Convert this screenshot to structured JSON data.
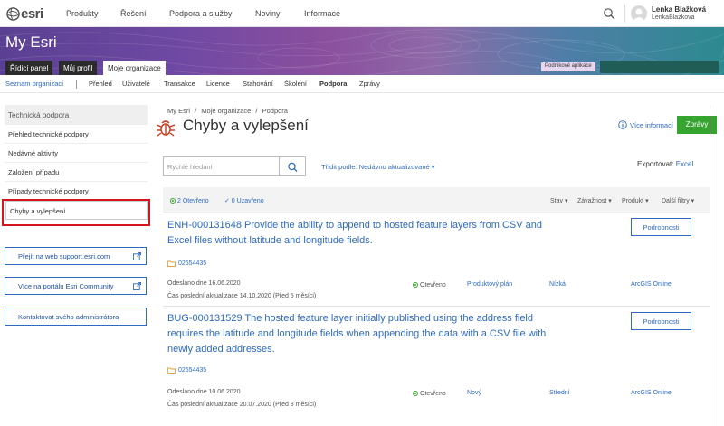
{
  "topnav": {
    "logo_text": "esri",
    "items": [
      "Produkty",
      "Řešení",
      "Podpora a služby",
      "Noviny",
      "Informace"
    ],
    "user_name": "Lenka Blažková",
    "user_login": "LenkaBlazkova"
  },
  "banner": {
    "title": "My Esri",
    "tabs": [
      "Řídicí panel",
      "Můj profil",
      "Moje organizace"
    ],
    "badge": "Podnikové aplikace"
  },
  "subnav": {
    "org_list": "Seznam organizací",
    "items": [
      "Přehled",
      "Uživatelé",
      "Transakce",
      "Licence",
      "Stahování",
      "Školení",
      "Podpora",
      "Zprávy"
    ]
  },
  "sidebar": {
    "heading": "Technická podpora",
    "items": [
      "Přehled technické podpory",
      "Nedávné aktivity",
      "Založení případu",
      "Případy technické podpory",
      "Chyby a vylepšení"
    ],
    "buttons": [
      "Přejít na web support.esri.com",
      "Více na portálu Esri Community",
      "Kontaktovat svého administrátora"
    ]
  },
  "main": {
    "breadcrumb": [
      "My Esri",
      "/",
      "Moje organizace",
      "/",
      "Podpora"
    ],
    "title": "Chyby a vylepšení",
    "info_link": "Více informací",
    "reports_btn": "Zprávy",
    "search_placeholder": "Rychlé hledání",
    "sort_label": "Třídit podle: Nedávno aktualizované ▾",
    "export_label": "Exportovat:",
    "export_link": "Excel",
    "filters": {
      "open": "2 Otevřeno",
      "closed": "✓ 0 Uzavřeno",
      "status": "Stav ▾",
      "severity": "Závažnost ▾",
      "product": "Produkt ▾",
      "more": "Další filtry ▾"
    }
  },
  "items": [
    {
      "title": "ENH-000131648 Provide the ability to append to hosted feature layers from CSV and Excel files without latitude and longitude fields.",
      "case": "02554435",
      "submitted": "Odesláno dne 16.06.2020",
      "updated": "Čas poslední aktualizace 14.10.2020 (Před 5 měsíci)",
      "status": "Otevřeno",
      "plan": "Produktový plán",
      "severity": "Nízká",
      "product": "ArcGIS Online",
      "details": "Podrobnosti"
    },
    {
      "title": "BUG-000131529 The hosted feature layer initially published using the address field requires the latitude and longitude fields  when appending the data with a CSV file with newly added addresses.",
      "case": "02554435",
      "submitted": "Odesláno dne 10.06.2020",
      "updated": "Čas poslední aktualizace 20.07.2020 (Před 8 měsíci)",
      "status": "Otevřeno",
      "plan": "Nový",
      "severity": "Střední",
      "product": "ArcGIS Online",
      "details": "Podrobnosti"
    }
  ]
}
